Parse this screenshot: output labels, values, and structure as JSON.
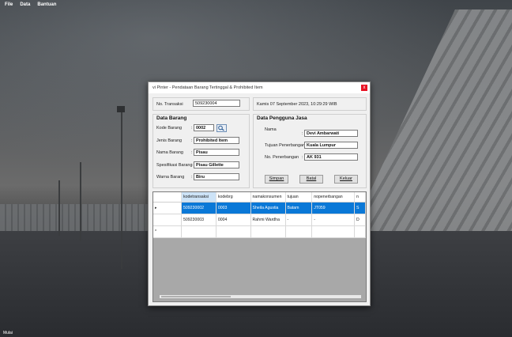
{
  "menu": [
    "File",
    "Data",
    "Bantuan"
  ],
  "status": "Mulai",
  "window": {
    "title": "vi Pinter - Pendataan Barang Tertinggal & Prohibited Item",
    "close": "x",
    "transaksi_label": "No. Transaksi",
    "transaksi_value": "509230004",
    "datetime": "Kamis 07 September 2023, 10:29:29 WIB",
    "barang": {
      "heading": "Data Barang",
      "rows": [
        {
          "label": "Kode Barang",
          "value": "0002"
        },
        {
          "label": "Jenis Barang",
          "value": "Prohibited Item"
        },
        {
          "label": "Nama Barang",
          "value": "Pisau"
        },
        {
          "label": "Spesifikasi Barang",
          "value": "Pisau Gillette"
        },
        {
          "label": "Warna Barang",
          "value": "Biru"
        }
      ]
    },
    "pengguna": {
      "heading": "Data Pengguna Jasa",
      "rows": [
        {
          "label": "Nama",
          "value": "Devi Ambarwati"
        },
        {
          "label": "Tujuan Penerbangan :",
          "value": "Kuala Lumpur"
        },
        {
          "label": "No. Penerbangan",
          "value": "AK 931"
        }
      ]
    },
    "buttons": {
      "simpan": "Simpan",
      "batal": "Batal",
      "keluar": "Keluar"
    },
    "grid": {
      "columns": [
        "kodetransaksi",
        "kodebrg",
        "namakonsumen",
        "tujuan",
        "nopenerbangan",
        "n"
      ],
      "rows": [
        {
          "marker": "▸",
          "cells": [
            "509230002",
            "0003",
            "Sheila Agustia",
            "Batam",
            "JT059",
            "S"
          ]
        },
        {
          "marker": "",
          "cells": [
            "509230003",
            "0004",
            "Rahmi Wardha",
            "-",
            "-",
            "D"
          ]
        },
        {
          "marker": "*",
          "cells": [
            "",
            "",
            "",
            "",
            "",
            ""
          ]
        }
      ]
    }
  },
  "colors": {
    "selection": "#0a78d7",
    "close": "#e81123"
  }
}
